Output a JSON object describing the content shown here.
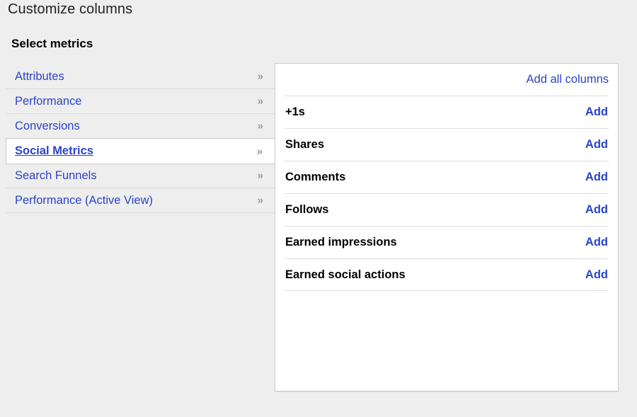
{
  "page": {
    "title": "Customize columns",
    "section_heading": "Select metrics"
  },
  "colors": {
    "link_blue": "#2b44c7",
    "background": "#eeeeee",
    "panel_background": "#ffffff",
    "separator": "#dddddd",
    "chevron_gray": "#999999"
  },
  "categories": {
    "items": [
      {
        "label": "Attributes",
        "chevron": "»",
        "selected": false
      },
      {
        "label": "Performance",
        "chevron": "»",
        "selected": false
      },
      {
        "label": "Conversions",
        "chevron": "»",
        "selected": false
      },
      {
        "label": "Social Metrics",
        "chevron": "»",
        "selected": true
      },
      {
        "label": "Search Funnels",
        "chevron": "»",
        "selected": false
      },
      {
        "label": "Performance (Active View)",
        "chevron": "»",
        "selected": false
      }
    ]
  },
  "metrics_panel": {
    "add_all_label": "Add all columns",
    "rows": [
      {
        "name": "+1s",
        "action": "Add"
      },
      {
        "name": "Shares",
        "action": "Add"
      },
      {
        "name": "Comments",
        "action": "Add"
      },
      {
        "name": "Follows",
        "action": "Add"
      },
      {
        "name": "Earned impressions",
        "action": "Add"
      },
      {
        "name": "Earned social actions",
        "action": "Add"
      }
    ]
  }
}
